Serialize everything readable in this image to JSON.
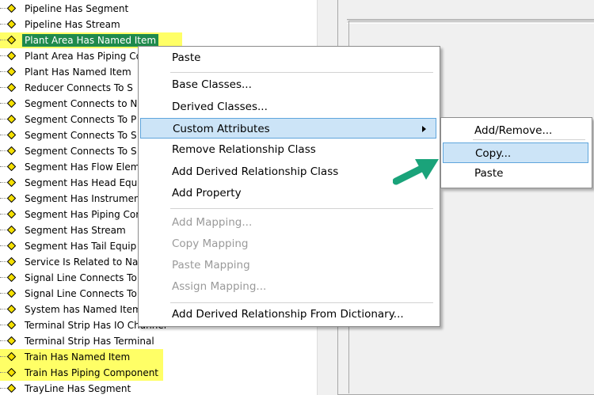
{
  "tree": {
    "items": [
      {
        "label": "Pipeline Has Segment",
        "highlight": false,
        "selected": false
      },
      {
        "label": "Pipeline Has Stream",
        "highlight": false,
        "selected": false
      },
      {
        "label": "Plant Area Has Named Item",
        "highlight": true,
        "selected": true
      },
      {
        "label": "Plant Area Has Piping Co",
        "highlight": false,
        "selected": false
      },
      {
        "label": "Plant Has Named Item",
        "highlight": false,
        "selected": false
      },
      {
        "label": "Reducer Connects To S",
        "highlight": false,
        "selected": false
      },
      {
        "label": "Segment Connects to N",
        "highlight": false,
        "selected": false
      },
      {
        "label": "Segment Connects To P",
        "highlight": false,
        "selected": false
      },
      {
        "label": "Segment Connects To S",
        "highlight": false,
        "selected": false
      },
      {
        "label": "Segment Connects To S",
        "highlight": false,
        "selected": false
      },
      {
        "label": "Segment Has Flow Elem",
        "highlight": false,
        "selected": false
      },
      {
        "label": "Segment Has Head Equ",
        "highlight": false,
        "selected": false
      },
      {
        "label": "Segment Has Instrumen",
        "highlight": false,
        "selected": false
      },
      {
        "label": "Segment Has Piping Cor",
        "highlight": false,
        "selected": false
      },
      {
        "label": "Segment Has Stream",
        "highlight": false,
        "selected": false
      },
      {
        "label": "Segment Has Tail Equip",
        "highlight": false,
        "selected": false
      },
      {
        "label": "Service Is Related to Na",
        "highlight": false,
        "selected": false
      },
      {
        "label": "Signal Line Connects To",
        "highlight": false,
        "selected": false
      },
      {
        "label": "Signal Line Connects To",
        "highlight": false,
        "selected": false
      },
      {
        "label": "System has Named Item",
        "highlight": false,
        "selected": false
      },
      {
        "label": "Terminal Strip Has IO Channel",
        "highlight": false,
        "selected": false
      },
      {
        "label": "Terminal Strip Has Terminal",
        "highlight": false,
        "selected": false
      },
      {
        "label": "Train Has Named Item",
        "highlight": true,
        "selected": false
      },
      {
        "label": "Train Has Piping Component",
        "highlight": true,
        "selected": false
      },
      {
        "label": "TrayLine Has Segment",
        "highlight": false,
        "selected": false
      }
    ],
    "highlight_color": "#ffff66",
    "selected_color": "#1f8a4c",
    "diamond_color": "#f5e000"
  },
  "context_menu": {
    "items": [
      {
        "label": "Paste",
        "disabled": false
      },
      {
        "separator": true
      },
      {
        "label": "Base Classes...",
        "disabled": false
      },
      {
        "label": "Derived Classes...",
        "disabled": false
      },
      {
        "label": "Custom Attributes",
        "disabled": false,
        "hover": true,
        "submenu": true
      },
      {
        "label": "Remove Relationship Class",
        "disabled": false
      },
      {
        "label": "Add Derived Relationship Class",
        "disabled": false
      },
      {
        "label": "Add Property",
        "disabled": false
      },
      {
        "separator": true
      },
      {
        "label": "Add Mapping...",
        "disabled": true
      },
      {
        "label": "Copy Mapping",
        "disabled": true
      },
      {
        "label": "Paste Mapping",
        "disabled": true
      },
      {
        "label": "Assign Mapping...",
        "disabled": true
      },
      {
        "separator": true
      },
      {
        "label": "Add Derived Relationship From Dictionary...",
        "disabled": false
      }
    ]
  },
  "submenu": {
    "items": [
      {
        "label": "Add/Remove...",
        "hover": false
      },
      {
        "separator": true
      },
      {
        "label": "Copy...",
        "hover": true
      },
      {
        "label": "Paste",
        "hover": false
      }
    ]
  },
  "colors": {
    "hover_bg": "#cce4f7",
    "hover_border": "#5fa5dc",
    "annotation_arrow": "#1aa37a"
  }
}
